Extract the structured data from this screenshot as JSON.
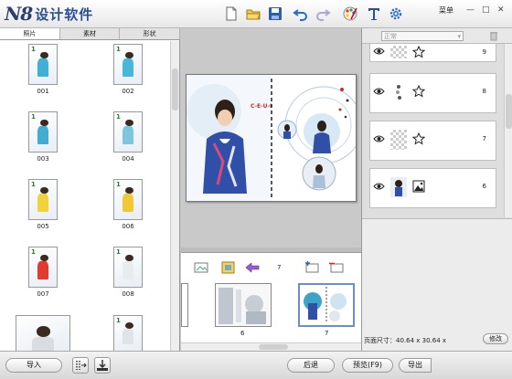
{
  "app": {
    "logo_mark": "N8",
    "title": "设计软件",
    "menu_label": "菜单",
    "window_controls": [
      "minimize",
      "maximize",
      "close"
    ]
  },
  "toolbar": {
    "icons": [
      "new-page-icon",
      "open-folder-icon",
      "save-icon",
      "undo-icon",
      "redo-icon",
      "color-palette-icon",
      "text-tool-icon",
      "settings-gear-icon"
    ]
  },
  "left_panel": {
    "tabs": [
      {
        "label": "照片",
        "active": true
      },
      {
        "label": "素材",
        "active": false
      },
      {
        "label": "形状",
        "active": false
      }
    ],
    "photos": [
      {
        "label": "001"
      },
      {
        "label": "002"
      },
      {
        "label": "003"
      },
      {
        "label": "004"
      },
      {
        "label": "005"
      },
      {
        "label": "006"
      },
      {
        "label": "007"
      },
      {
        "label": "008"
      },
      {
        "label": ""
      },
      {
        "label": ""
      }
    ]
  },
  "canvas": {
    "decor_text": "C-E-U-H"
  },
  "page_strip": {
    "count": "7",
    "pages": [
      {
        "label": "6"
      },
      {
        "label": "7"
      }
    ]
  },
  "layers_panel": {
    "blend_mode": "正常",
    "layers": [
      {
        "number": "9",
        "type": "star-shape"
      },
      {
        "number": "8",
        "type": "star-shape"
      },
      {
        "number": "7",
        "type": "star-shape"
      },
      {
        "number": "6",
        "type": "image"
      }
    ],
    "page_size_label": "页面尺寸：40.64 x 30.64 x",
    "modify_label": "修改"
  },
  "bottom_bar": {
    "import_label": "导入",
    "back_label": "后退",
    "preview_label": "预览(F9)",
    "export_label": "导出"
  },
  "colors": {
    "brand_blue": "#2a4f93",
    "badge_green": "#2a7d2a"
  }
}
